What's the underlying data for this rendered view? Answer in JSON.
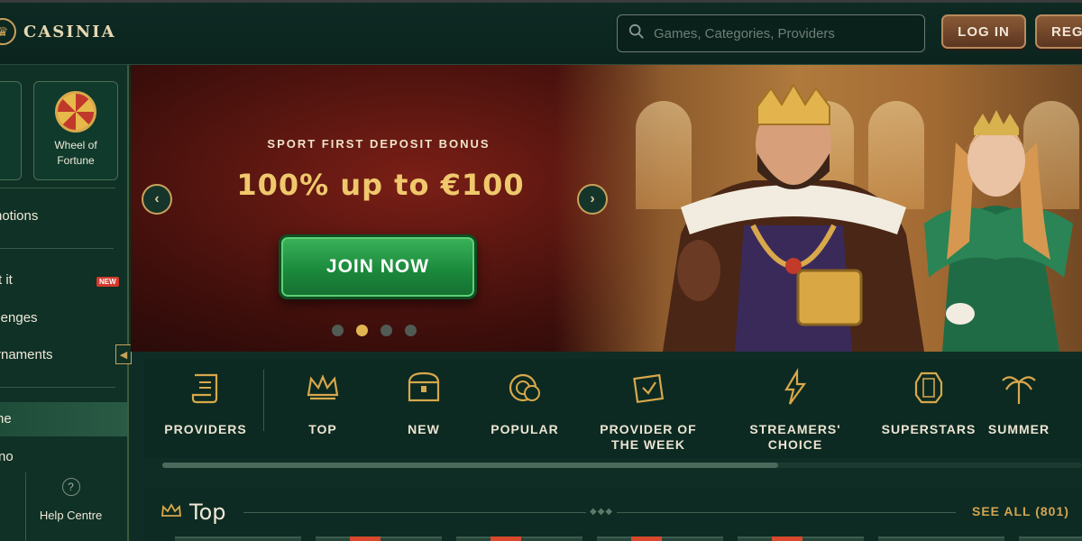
{
  "header": {
    "logo_text": "CASINIA",
    "search_placeholder": "Games, Categories, Providers",
    "login_label": "LOG IN",
    "register_label": "REGI"
  },
  "sidebar": {
    "wheel_label": "Wheel of Fortune",
    "items": [
      {
        "label": "notions"
      },
      {
        "label": "t it",
        "badge": "NEW"
      },
      {
        "label": "llenges"
      },
      {
        "label": "rnaments"
      },
      {
        "label": "ne"
      },
      {
        "label": "no"
      }
    ],
    "help_label": "Help Centre",
    "help_icon": "?"
  },
  "banner": {
    "subtitle": "SPORT FIRST DEPOSIT BONUS",
    "title": "100% up to €100",
    "cta": "JOIN NOW",
    "prev_icon": "‹",
    "next_icon": "›",
    "slides_count": 4,
    "active_slide": 2
  },
  "categories": [
    {
      "label": "PROVIDERS",
      "icon": "scroll-icon"
    },
    {
      "label": "TOP",
      "icon": "crown-icon"
    },
    {
      "label": "NEW",
      "icon": "chest-icon"
    },
    {
      "label": "POPULAR",
      "icon": "chips-icon"
    },
    {
      "label": "PROVIDER OF THE WEEK",
      "icon": "calendar-icon"
    },
    {
      "label": "STREAMERS' CHOICE",
      "icon": "lightning-icon"
    },
    {
      "label": "SUPERSTARS",
      "icon": "gem-icon"
    },
    {
      "label": "SUMMER",
      "icon": "palm-icon"
    }
  ],
  "section": {
    "title": "Top",
    "see_all": "SEE ALL (801)"
  },
  "colors": {
    "gold": "#c9a15a",
    "green_cta": "#1b8a3c",
    "background": "#0f2d25"
  }
}
